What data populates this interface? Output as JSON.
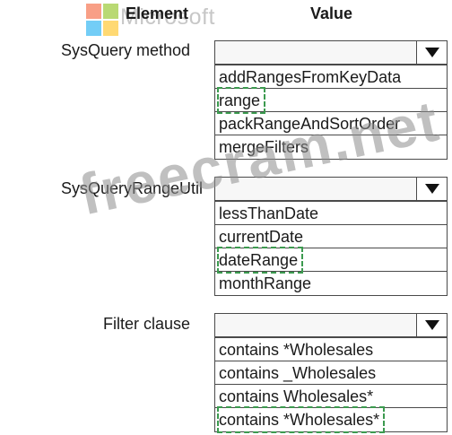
{
  "header": {
    "element": "Element",
    "value": "Value"
  },
  "logo_text": "Microsoft",
  "watermark": "freecram.net",
  "colors": {
    "selection_outline": "#3c9a4f",
    "border": "#4a4a4a"
  },
  "rows": [
    {
      "label": "SysQuery method",
      "options": [
        "addRangesFromKeyData",
        "range",
        "packRangeAndSortOrder",
        "mergeFilters"
      ],
      "selected_index": 1
    },
    {
      "label": "SysQueryRangeUtil",
      "options": [
        "lessThanDate",
        "currentDate",
        "dateRange",
        "monthRange"
      ],
      "selected_index": 2
    },
    {
      "label": "Filter clause",
      "options": [
        "contains *Wholesales",
        "contains _Wholesales",
        "contains Wholesales*",
        "contains *Wholesales*"
      ],
      "selected_index": 3
    }
  ]
}
